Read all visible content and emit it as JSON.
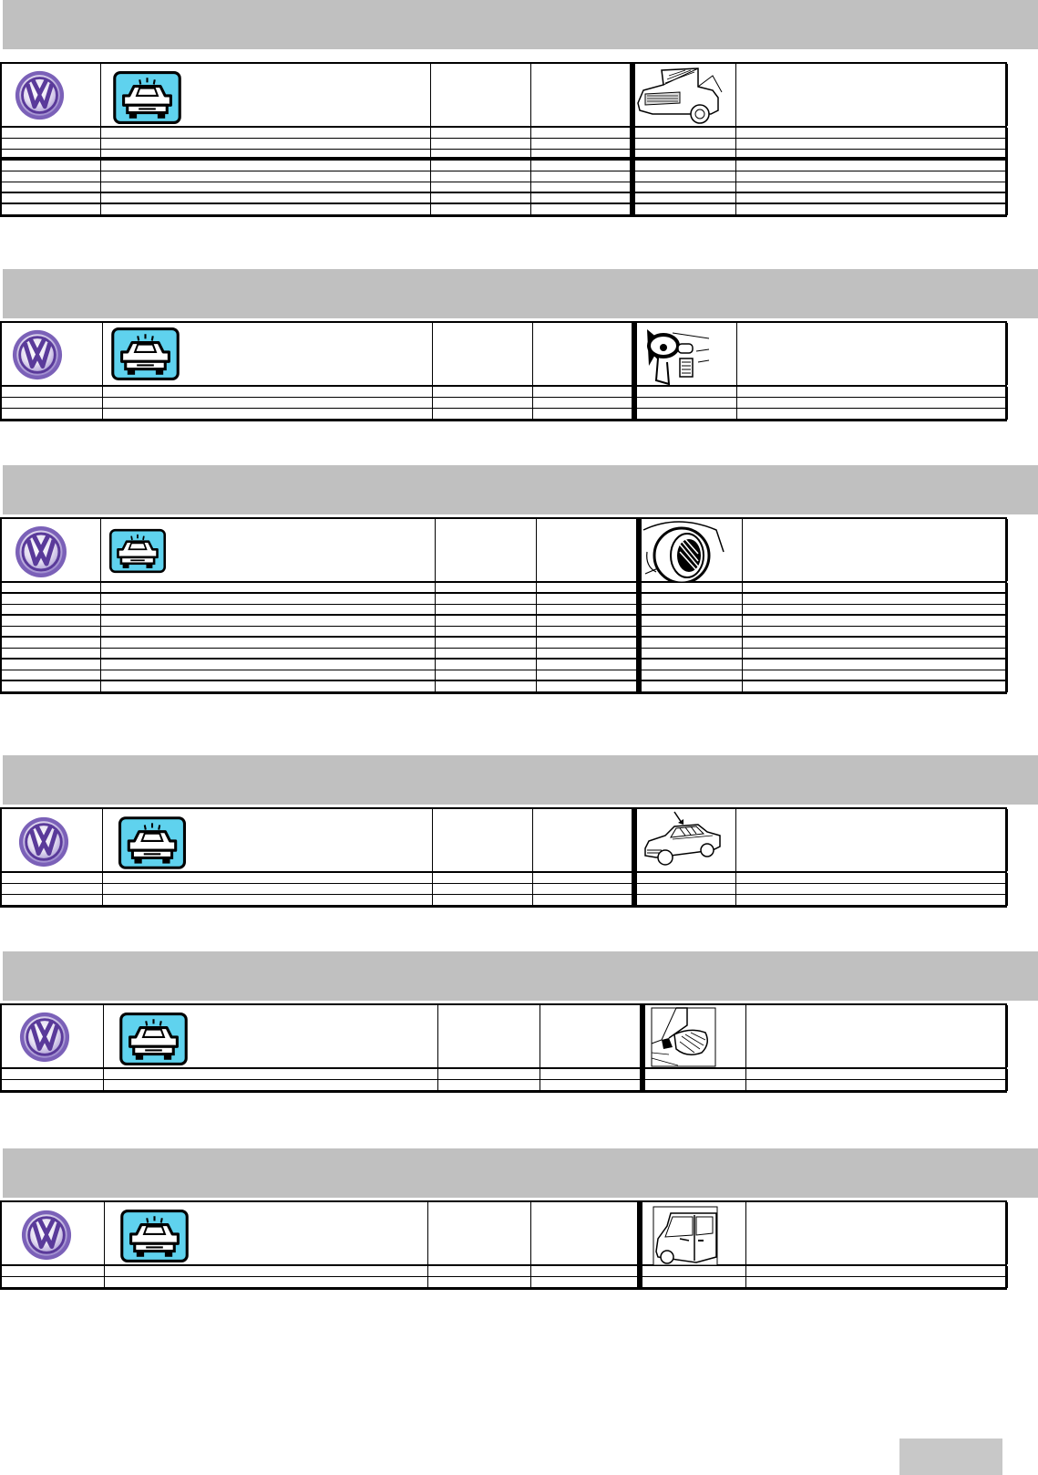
{
  "colors": {
    "banner": "#c0c0c0",
    "vw_purple": "#5a3a9a",
    "vw_ring": "#7b61b8",
    "badge_cyan": "#5fd2ee",
    "page_tab": "#c8c8c8"
  },
  "sections": [
    {
      "logo_icon": "vw-logo-icon",
      "badge_icon": "car-wash-icon",
      "pictogram_icon": "open-hood-car-icon",
      "row_count": 8
    },
    {
      "logo_icon": "vw-logo-icon",
      "badge_icon": "car-wash-icon",
      "pictogram_icon": "dashboard-steering-wheel-icon",
      "row_count": 3
    },
    {
      "logo_icon": "vw-logo-icon",
      "badge_icon": "car-wash-icon",
      "pictogram_icon": "wheel-rim-icon",
      "row_count": 10
    },
    {
      "logo_icon": "vw-logo-icon",
      "badge_icon": "car-wash-icon",
      "pictogram_icon": "car-roof-arrow-icon",
      "row_count": 3
    },
    {
      "logo_icon": "vw-logo-icon",
      "badge_icon": "car-wash-icon",
      "pictogram_icon": "side-mirror-icon",
      "row_count": 2
    },
    {
      "logo_icon": "vw-logo-icon",
      "badge_icon": "car-wash-icon",
      "pictogram_icon": "car-door-icon",
      "row_count": 2
    }
  ]
}
